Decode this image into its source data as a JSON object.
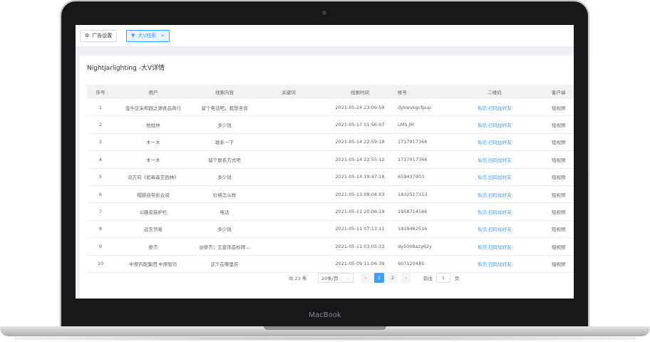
{
  "device": {
    "brand": "MacBook"
  },
  "tabs": [
    {
      "label": "广告设置",
      "icon": "gear-icon",
      "active": false
    },
    {
      "label": "大V线索",
      "icon": "filter-icon",
      "active": true,
      "close": "×"
    }
  ],
  "page": {
    "title": "Nightjarlighting -大V详情"
  },
  "table": {
    "headers": [
      "序号",
      "用户",
      "线索内容",
      "关键词",
      "线索时间",
      "帐号",
      "二维码",
      "客户端"
    ],
    "rows": [
      {
        "no": "1",
        "user": "金牛区采和园之源食品商行",
        "content": "留个电话吧，我想咨询",
        "keyword": "",
        "time": "2021-05-24 23:09:59",
        "account": "dykwvkgcfpup",
        "qr": "私信 扫码加好友",
        "client": "短视频"
      },
      {
        "no": "2",
        "user": "他姓林",
        "content": "多少钱",
        "keyword": "",
        "time": "2021-05-17 01:56:07",
        "account": "LMS.JM",
        "qr": "私信 扫码加好友",
        "client": "短视频"
      },
      {
        "no": "3",
        "user": "木一木",
        "content": "联系一下",
        "keyword": "",
        "time": "2021-05-14 22:59:18",
        "account": "1717917366",
        "qr": "私信 扫码加好友",
        "client": "短视频"
      },
      {
        "no": "4",
        "user": "木一木",
        "content": "留个联系方式吧",
        "keyword": "",
        "time": "2021-05-14 22:55:12",
        "account": "1717917366",
        "qr": "私信 扫码加好友",
        "client": "短视频"
      },
      {
        "no": "5",
        "user": "没方向《如皋森艺园林》",
        "content": "多少钱",
        "keyword": "",
        "time": "2021-05-14 19:47:18",
        "account": "659437903",
        "qr": "私信 扫码加好友",
        "client": "短视频"
      },
      {
        "no": "6",
        "user": "帽跡自带彩云间",
        "content": "价格怎么样",
        "keyword": "",
        "time": "2021-05-13 08:04:53",
        "account": "1832517313",
        "qr": "私信 扫码加好友",
        "client": "短视频"
      },
      {
        "no": "7",
        "user": "公路安装护栏",
        "content": "电话",
        "keyword": "",
        "time": "2021-05-11 20:06:19",
        "account": "1958714586",
        "qr": "私信 扫码加好友",
        "client": "短视频"
      },
      {
        "no": "8",
        "user": "远东贸易",
        "content": "多少钱",
        "keyword": "",
        "time": "2021-05-11 07:13:11",
        "account": "1818482516",
        "qr": "私信 扫码加好友",
        "client": "短视频"
      },
      {
        "no": "9",
        "user": "廖杰",
        "content": "@廖杰：五金饰品标牌…",
        "keyword": "",
        "time": "2021-05-11 03:05:33",
        "account": "dy5008azy62y",
        "qr": "私信 扫码加好友",
        "client": "短视频"
      },
      {
        "no": "10",
        "user": "中原内配集团 中原智信",
        "content": "这个在哪里买",
        "keyword": "",
        "time": "2021-05-09 11:06:39",
        "account": "607120485",
        "qr": "私信 扫码加好友",
        "client": "短视频"
      }
    ]
  },
  "pagination": {
    "total": "共 23 条",
    "page_size": "20条/页",
    "pages": [
      "1",
      "2"
    ],
    "current": "1",
    "goto_label": "前往",
    "goto_value": "1",
    "unit": "页"
  },
  "colors": {
    "primary": "#409eff",
    "header_bg": "#f0f2f5",
    "text": "#606266"
  }
}
